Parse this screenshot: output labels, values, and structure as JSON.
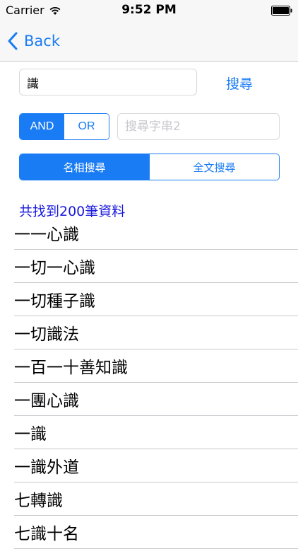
{
  "status_bar": {
    "carrier": "Carrier",
    "time": "9:52 PM"
  },
  "nav": {
    "back_label": "Back"
  },
  "search": {
    "value": "識",
    "button_label": "搜尋",
    "second_placeholder": "搜尋字串2"
  },
  "logic": {
    "and_label": "AND",
    "or_label": "OR",
    "selected": "AND"
  },
  "mode": {
    "name_label": "名相搜尋",
    "fulltext_label": "全文搜尋",
    "selected": "名相搜尋"
  },
  "results": {
    "count_text": "共找到200筆資料",
    "items": [
      "一一心識",
      "一切一心識",
      "一切種子識",
      "一切識法",
      "一百一十善知識",
      "一團心識",
      "一識",
      "一識外道",
      "七轉識",
      "七識十名"
    ]
  },
  "colors": {
    "accent": "#1a7cf4",
    "count_text": "#1a1adc"
  }
}
